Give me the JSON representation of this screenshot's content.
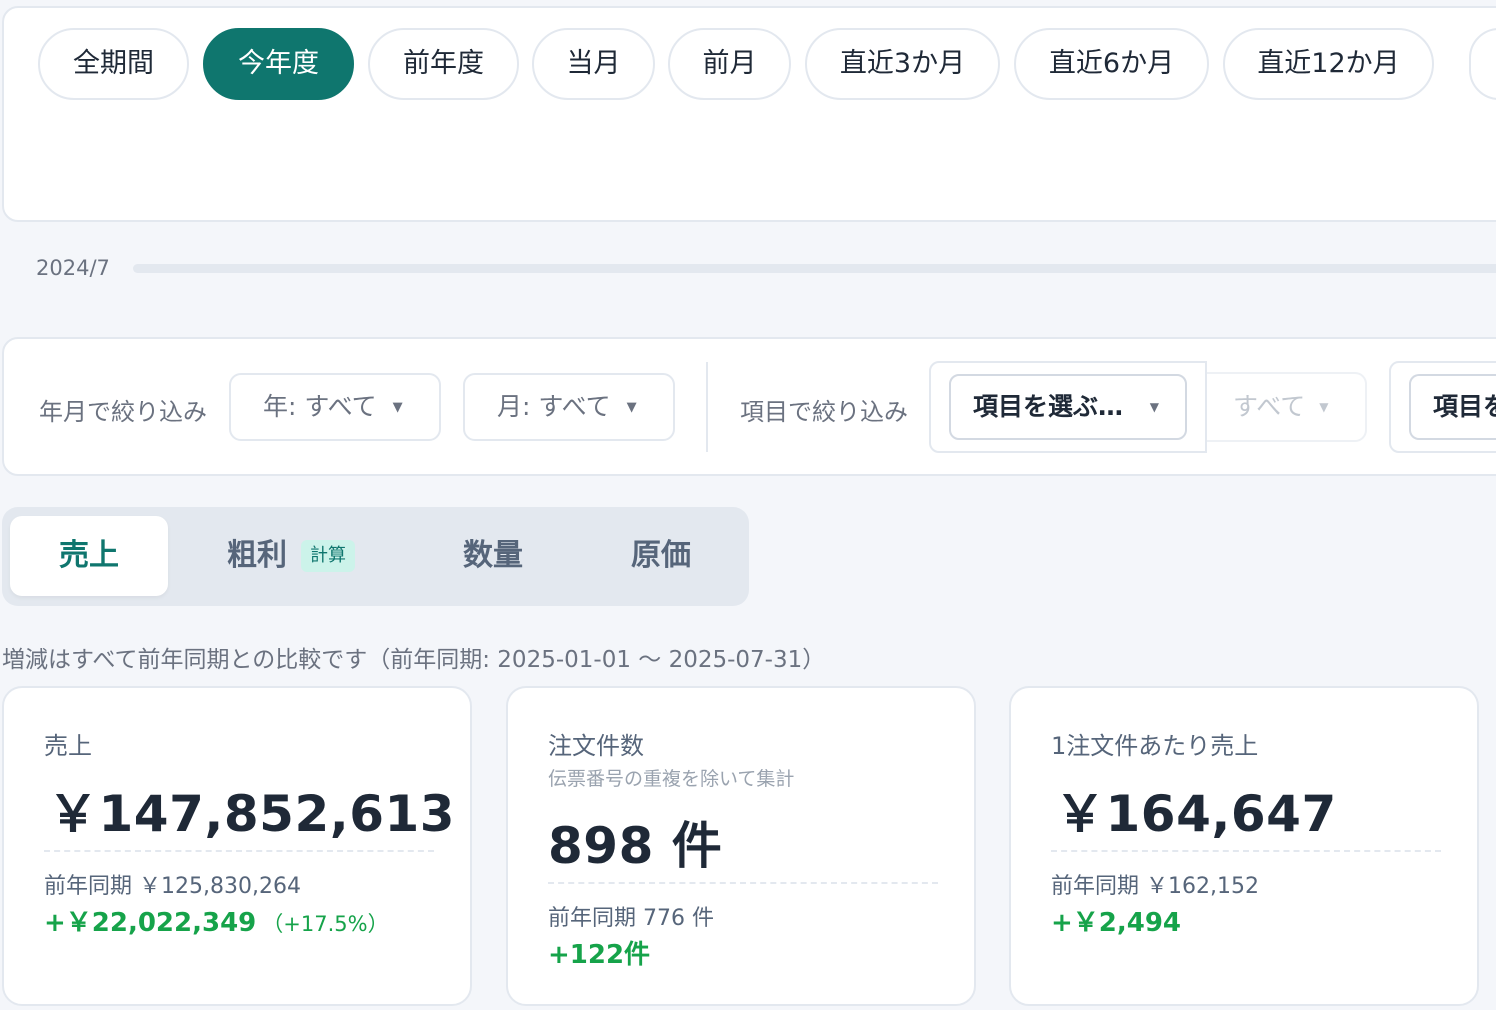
{
  "period": {
    "presets": [
      {
        "label": "全期間",
        "active": false
      },
      {
        "label": "今年度",
        "active": true
      },
      {
        "label": "前年度",
        "active": false
      },
      {
        "label": "当月",
        "active": false
      },
      {
        "label": "前月",
        "active": false
      },
      {
        "label": "直近3か月",
        "active": false
      },
      {
        "label": "直近6か月",
        "active": false
      },
      {
        "label": "直近12か月",
        "active": false
      }
    ]
  },
  "range": {
    "start_label": "2024/7"
  },
  "filters": {
    "date_label": "年月で絞り込み",
    "year_select": "年: すべて",
    "month_select": "月: すべて",
    "item_label": "項目で絞り込み",
    "item_select": "項目を選ぶ…",
    "value_select": "すべて",
    "item_select_2": "項目を"
  },
  "tabs": [
    {
      "label": "売上",
      "active": true
    },
    {
      "label": "粗利",
      "badge": "計算",
      "active": false
    },
    {
      "label": "数量",
      "active": false
    },
    {
      "label": "原価",
      "active": false
    }
  ],
  "compare_note": "増減はすべて前年同期との比較です（前年同期: 2025-01-01 ～ 2025-07-31）",
  "kpis": [
    {
      "title": "売上",
      "value": "￥147,852,613",
      "prev": "前年同期 ￥125,830,264",
      "delta": "+￥22,022,349",
      "delta_pct": "（+17.5%）"
    },
    {
      "title": "注文件数",
      "subtitle": "伝票番号の重複を除いて集計",
      "value": "898 件",
      "prev": "前年同期 776 件",
      "delta": "+122件"
    },
    {
      "title": "1注文件あたり売上",
      "value": "￥164,647",
      "prev": "前年同期 ￥162,152",
      "delta": "+￥2,494"
    }
  ],
  "colors": {
    "accent": "#0f766e",
    "positive": "#16a34a",
    "background": "#f4f6fa",
    "border": "#e3e8ef"
  }
}
